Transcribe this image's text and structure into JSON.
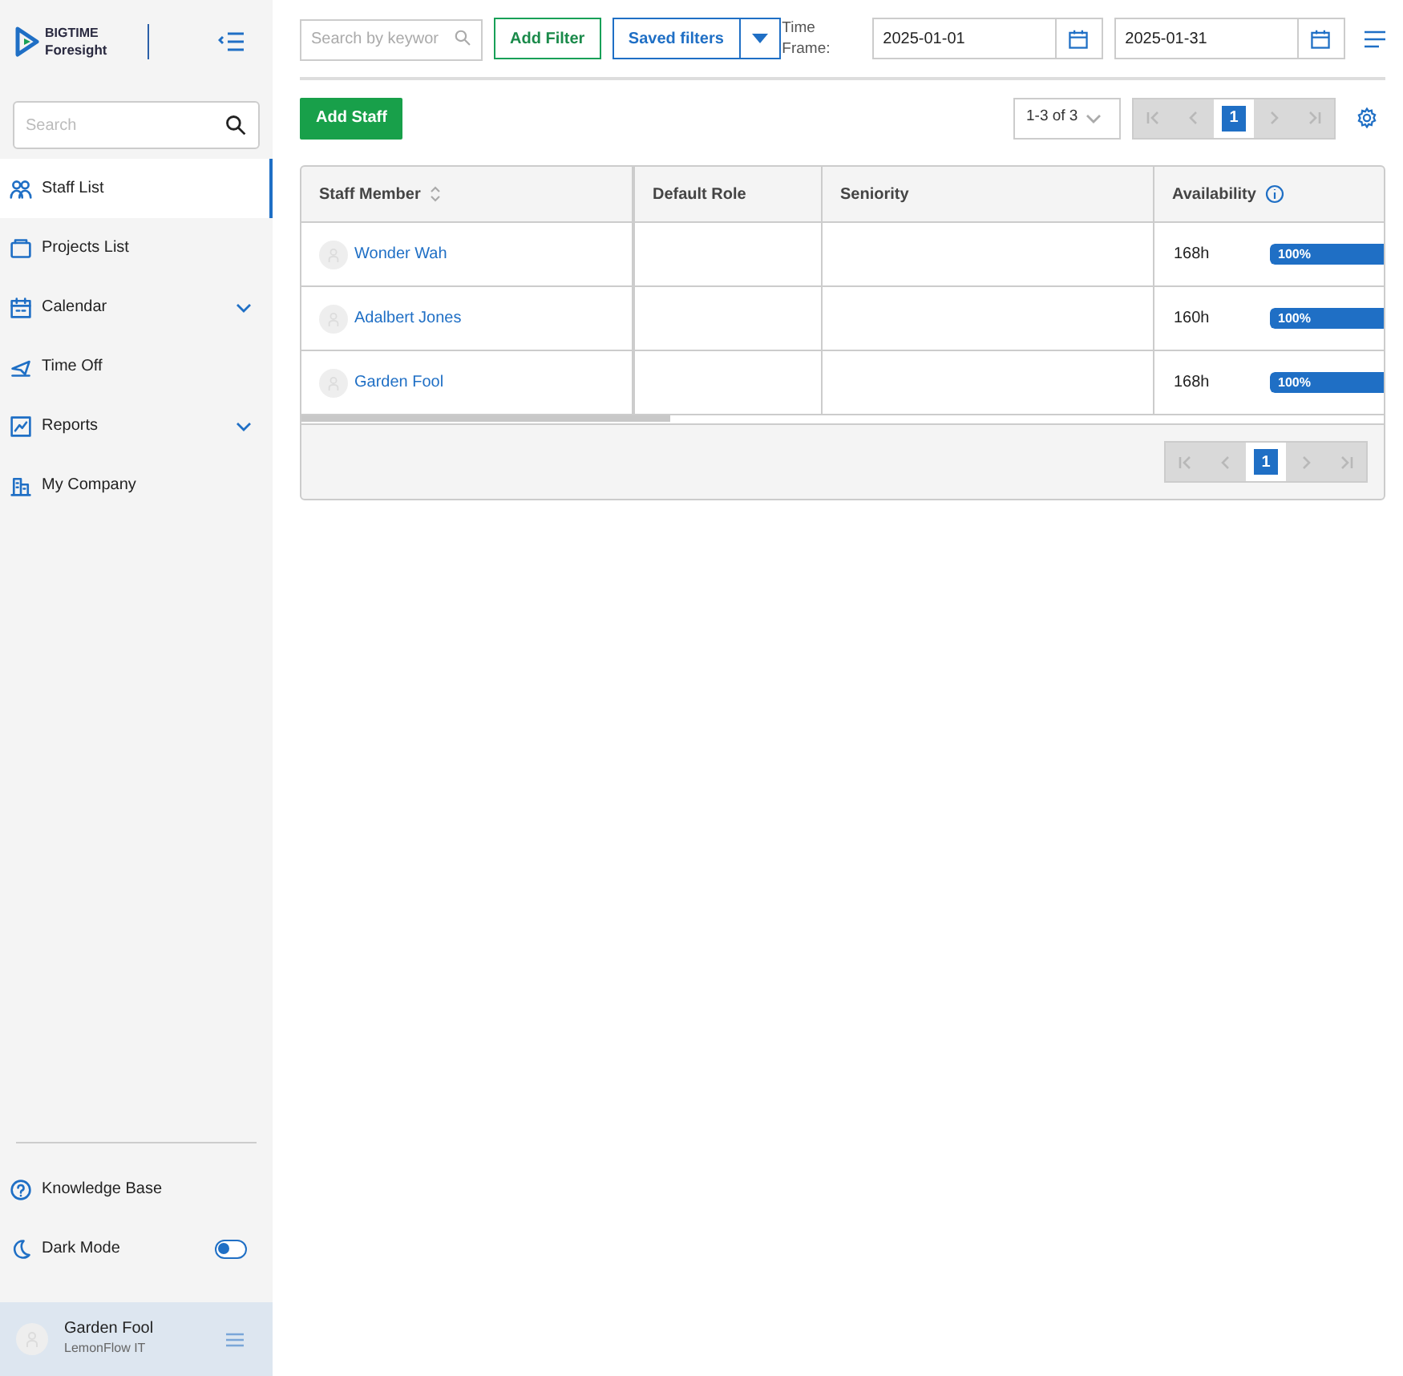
{
  "brand": {
    "line1": "BIGTIME",
    "line2": "Foresight"
  },
  "sidebar": {
    "search": {
      "placeholder": "Search"
    },
    "items": [
      {
        "label": "Staff List",
        "kind": "link",
        "selected": true
      },
      {
        "label": "Projects List",
        "kind": "link",
        "selected": false
      },
      {
        "label": "Calendar",
        "kind": "group",
        "selected": false
      },
      {
        "label": "Time Off",
        "kind": "link",
        "selected": false
      },
      {
        "label": "Reports",
        "kind": "group",
        "selected": false
      },
      {
        "label": "My Company",
        "kind": "link",
        "selected": false
      }
    ],
    "footer_items": [
      {
        "label": "Knowledge Base",
        "kind": "link"
      },
      {
        "label": "Dark Mode",
        "kind": "toggle",
        "on": false
      }
    ],
    "user": {
      "name": "Garden Fool",
      "company": "LemonFlow IT"
    }
  },
  "toolbar": {
    "search": {
      "placeholder": "Search by keywor"
    },
    "add_filter": "Add Filter",
    "saved_filters": "Saved filters",
    "time_frame_label": "Time Frame:",
    "date_from": "2025-01-01",
    "date_to": "2025-01-31"
  },
  "add_staff": "Add Staff",
  "page_size": "1-3 of 3",
  "pages": [
    {
      "label": "1",
      "selected": true
    }
  ],
  "table": {
    "columns": [
      {
        "label": "Staff Member",
        "sortable": true,
        "info": false
      },
      {
        "label": "Default Role",
        "sortable": false,
        "info": false
      },
      {
        "label": "Seniority",
        "sortable": false,
        "info": false
      },
      {
        "label": "Availability",
        "sortable": false,
        "info": true
      }
    ],
    "rows": [
      {
        "name": "Wonder Wah",
        "hours": "168h",
        "availability": "100%",
        "level": 1
      },
      {
        "name": "Adalbert Jones",
        "hours": "160h",
        "availability": "100%",
        "level": 1
      },
      {
        "name": "Garden Fool",
        "hours": "168h",
        "availability": "100%",
        "level": 1
      }
    ]
  },
  "bottom_pages": [
    {
      "label": "1",
      "selected": true
    }
  ]
}
